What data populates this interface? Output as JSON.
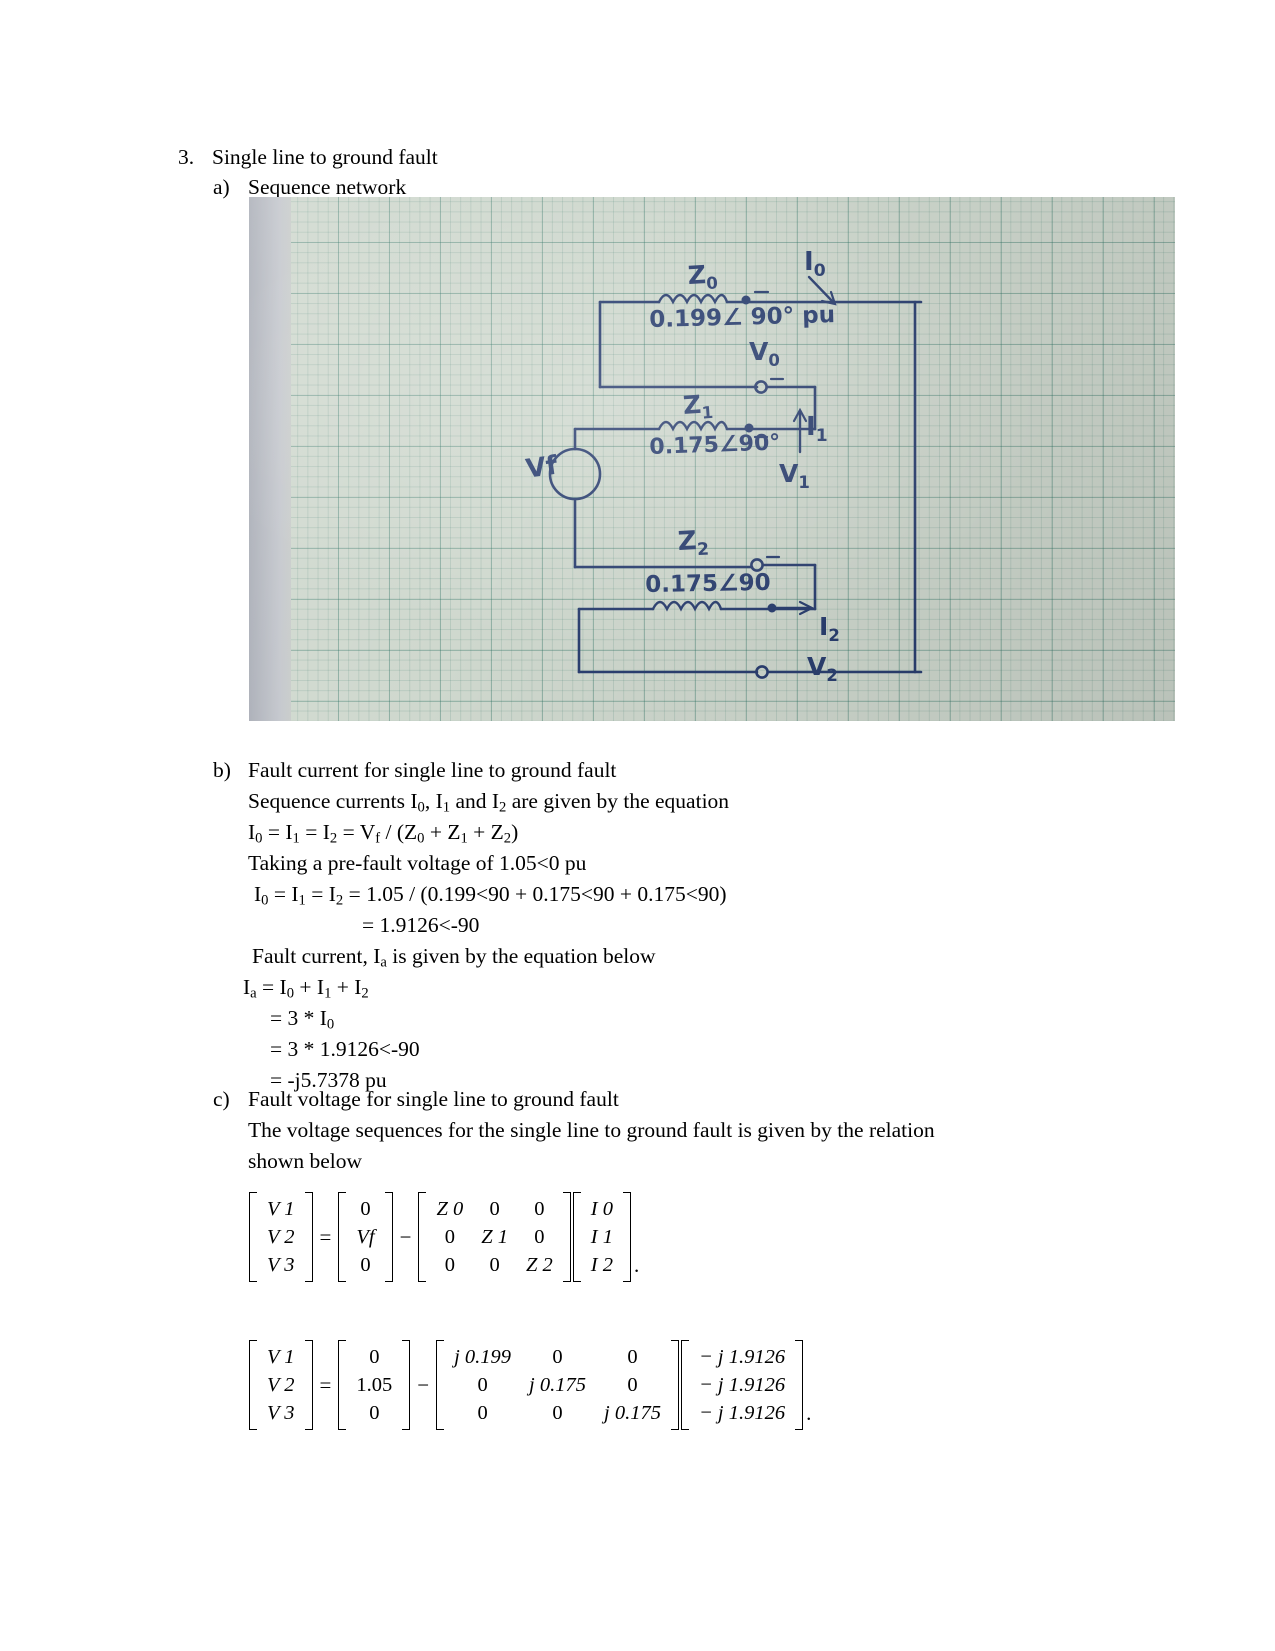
{
  "document": {
    "section_number": "3.",
    "section_title": "Single line to ground fault",
    "part_a": {
      "label": "a)",
      "title": "Sequence network"
    },
    "figure": {
      "alt": "hand-drawn sequence network diagram on green graph paper",
      "annotations": {
        "z0_label": "Z0",
        "z0_value": "0.199∠ 90° pu",
        "i0_label": "I0",
        "v0_label": "V0",
        "z1_label": "Z1",
        "z1_value": "0.175∠90°",
        "i1_label": "I1",
        "v1_label": "V1",
        "z2_label": "Z2",
        "z2_value": "0.175∠90",
        "i2_label": "I2",
        "v2_label": "V2",
        "source_label": "Vf"
      }
    },
    "part_b": {
      "label": "b)",
      "title": "Fault current for single line to ground fault",
      "lines": [
        "Sequence currents I0, I1 and I2 are given by the equation",
        "I0 = I1 = I2 = Vf / (Z0 + Z1 + Z2)",
        "Taking a pre-fault voltage of 1.05<0 pu",
        "I0 = I1 = I2 = 1.05 / (0.199<90 + 0.175<90 + 0.175<90)",
        "= 1.9126<-90",
        "Fault current, Ia is given by the equation below",
        "Ia = I0 + I1 + I2",
        "= 3 * I0",
        "= 3 * 1.9126<-90",
        "= -j5.7378 pu"
      ]
    },
    "part_c": {
      "label": "c)",
      "title": "Fault voltage for single line to ground fault",
      "lines": [
        "The voltage sequences for the single line to ground fault is given by the relation",
        "shown below"
      ],
      "matrix_eq_1": {
        "lhs": [
          "V 1",
          "V 2",
          "V 3"
        ],
        "equals": "=",
        "vf_vector": [
          "0",
          "Vf",
          "0"
        ],
        "minus": "−",
        "impedance": [
          [
            "Z 0",
            "0",
            "0"
          ],
          [
            "0",
            "Z 1",
            "0"
          ],
          [
            "0",
            "0",
            "Z 2"
          ]
        ],
        "current": [
          "I 0",
          "I 1",
          "I 2"
        ],
        "trailing": "."
      },
      "matrix_eq_2": {
        "lhs": [
          "V 1",
          "V 2",
          "V 3"
        ],
        "equals": "=",
        "vf_vector": [
          "0",
          "1.05",
          "0"
        ],
        "minus": "−",
        "impedance": [
          [
            "j 0.199",
            "0",
            "0"
          ],
          [
            "0",
            "j 0.175",
            "0"
          ],
          [
            "0",
            "0",
            "j 0.175"
          ]
        ],
        "current": [
          "− j 1.9126",
          "− j 1.9126",
          "− j 1.9126"
        ],
        "trailing": "."
      }
    }
  },
  "colors": {
    "ink": "#2b3f70",
    "paper": "#cfd8ce",
    "grid": "#2a6e5f",
    "text": "#000000"
  }
}
